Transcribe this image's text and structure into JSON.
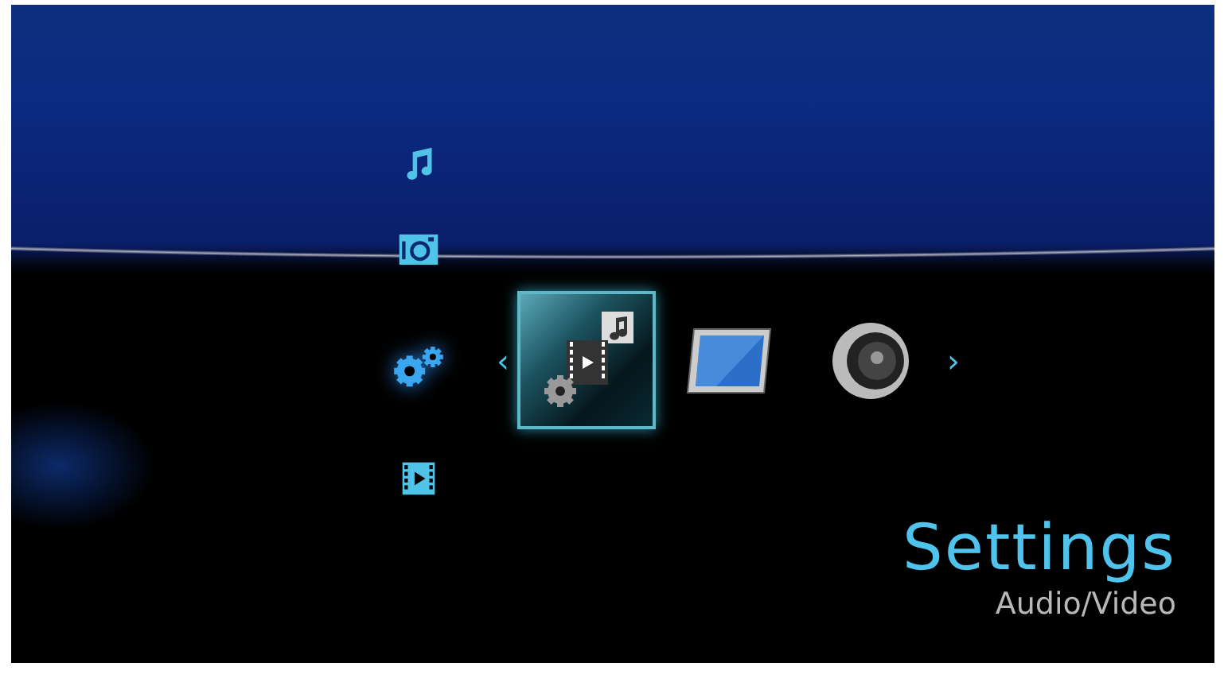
{
  "categories": [
    {
      "kind": "music",
      "selected": false
    },
    {
      "kind": "photo",
      "selected": false
    },
    {
      "kind": "settings",
      "selected": true
    },
    {
      "kind": "video",
      "selected": false
    }
  ],
  "carousel": {
    "prev": "‹",
    "next": "›",
    "items": [
      {
        "kind": "audio-video",
        "selected": true
      },
      {
        "kind": "display",
        "selected": false
      },
      {
        "kind": "speaker",
        "selected": false
      }
    ]
  },
  "title": "Settings",
  "subtitle": "Audio/Video"
}
